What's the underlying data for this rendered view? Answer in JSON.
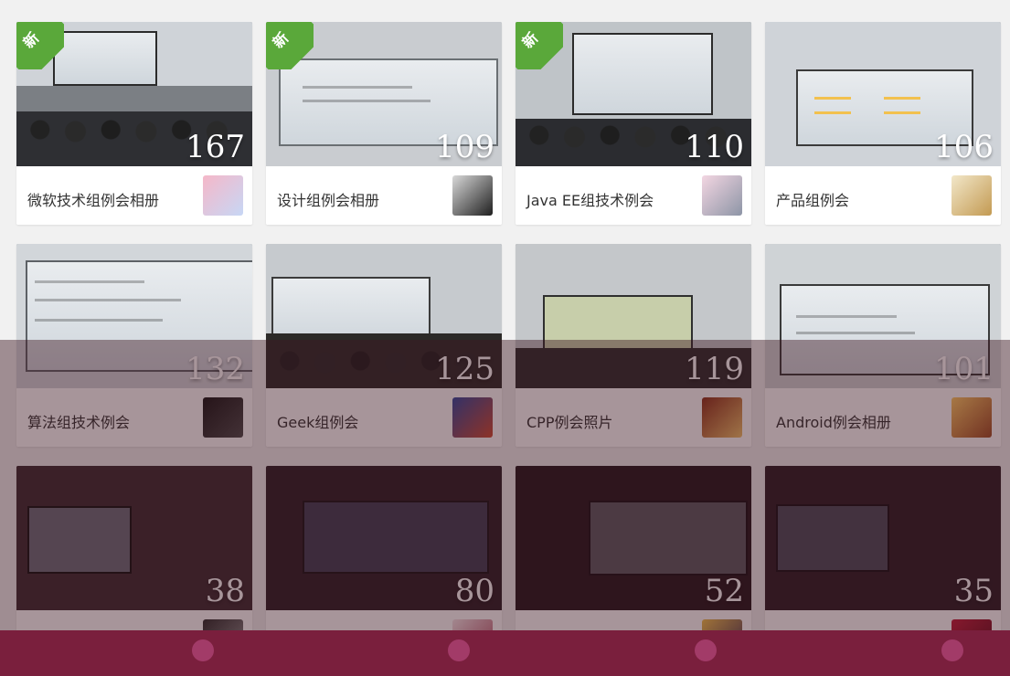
{
  "new_badge": "新",
  "albums": [
    {
      "name": "微软技术组例会相册",
      "count": "167",
      "is_new": true
    },
    {
      "name": "设计组例会相册",
      "count": "109",
      "is_new": true
    },
    {
      "name": "Java EE组技术例会",
      "count": "110",
      "is_new": true
    },
    {
      "name": "产品组例会",
      "count": "106",
      "is_new": false
    },
    {
      "name": "算法组技术例会",
      "count": "132",
      "is_new": false
    },
    {
      "name": "Geek组例会",
      "count": "125",
      "is_new": false
    },
    {
      "name": "CPP例会照片",
      "count": "119",
      "is_new": false
    },
    {
      "name": "Android例会相册",
      "count": "101",
      "is_new": false
    },
    {
      "name": "",
      "count": "38",
      "is_new": false
    },
    {
      "name": "",
      "count": "80",
      "is_new": false
    },
    {
      "name": "",
      "count": "52",
      "is_new": false
    },
    {
      "name": "",
      "count": "35",
      "is_new": false
    }
  ],
  "colors": {
    "ribbon_green": "#5aa83a",
    "overlay": "#7a1f3d"
  }
}
